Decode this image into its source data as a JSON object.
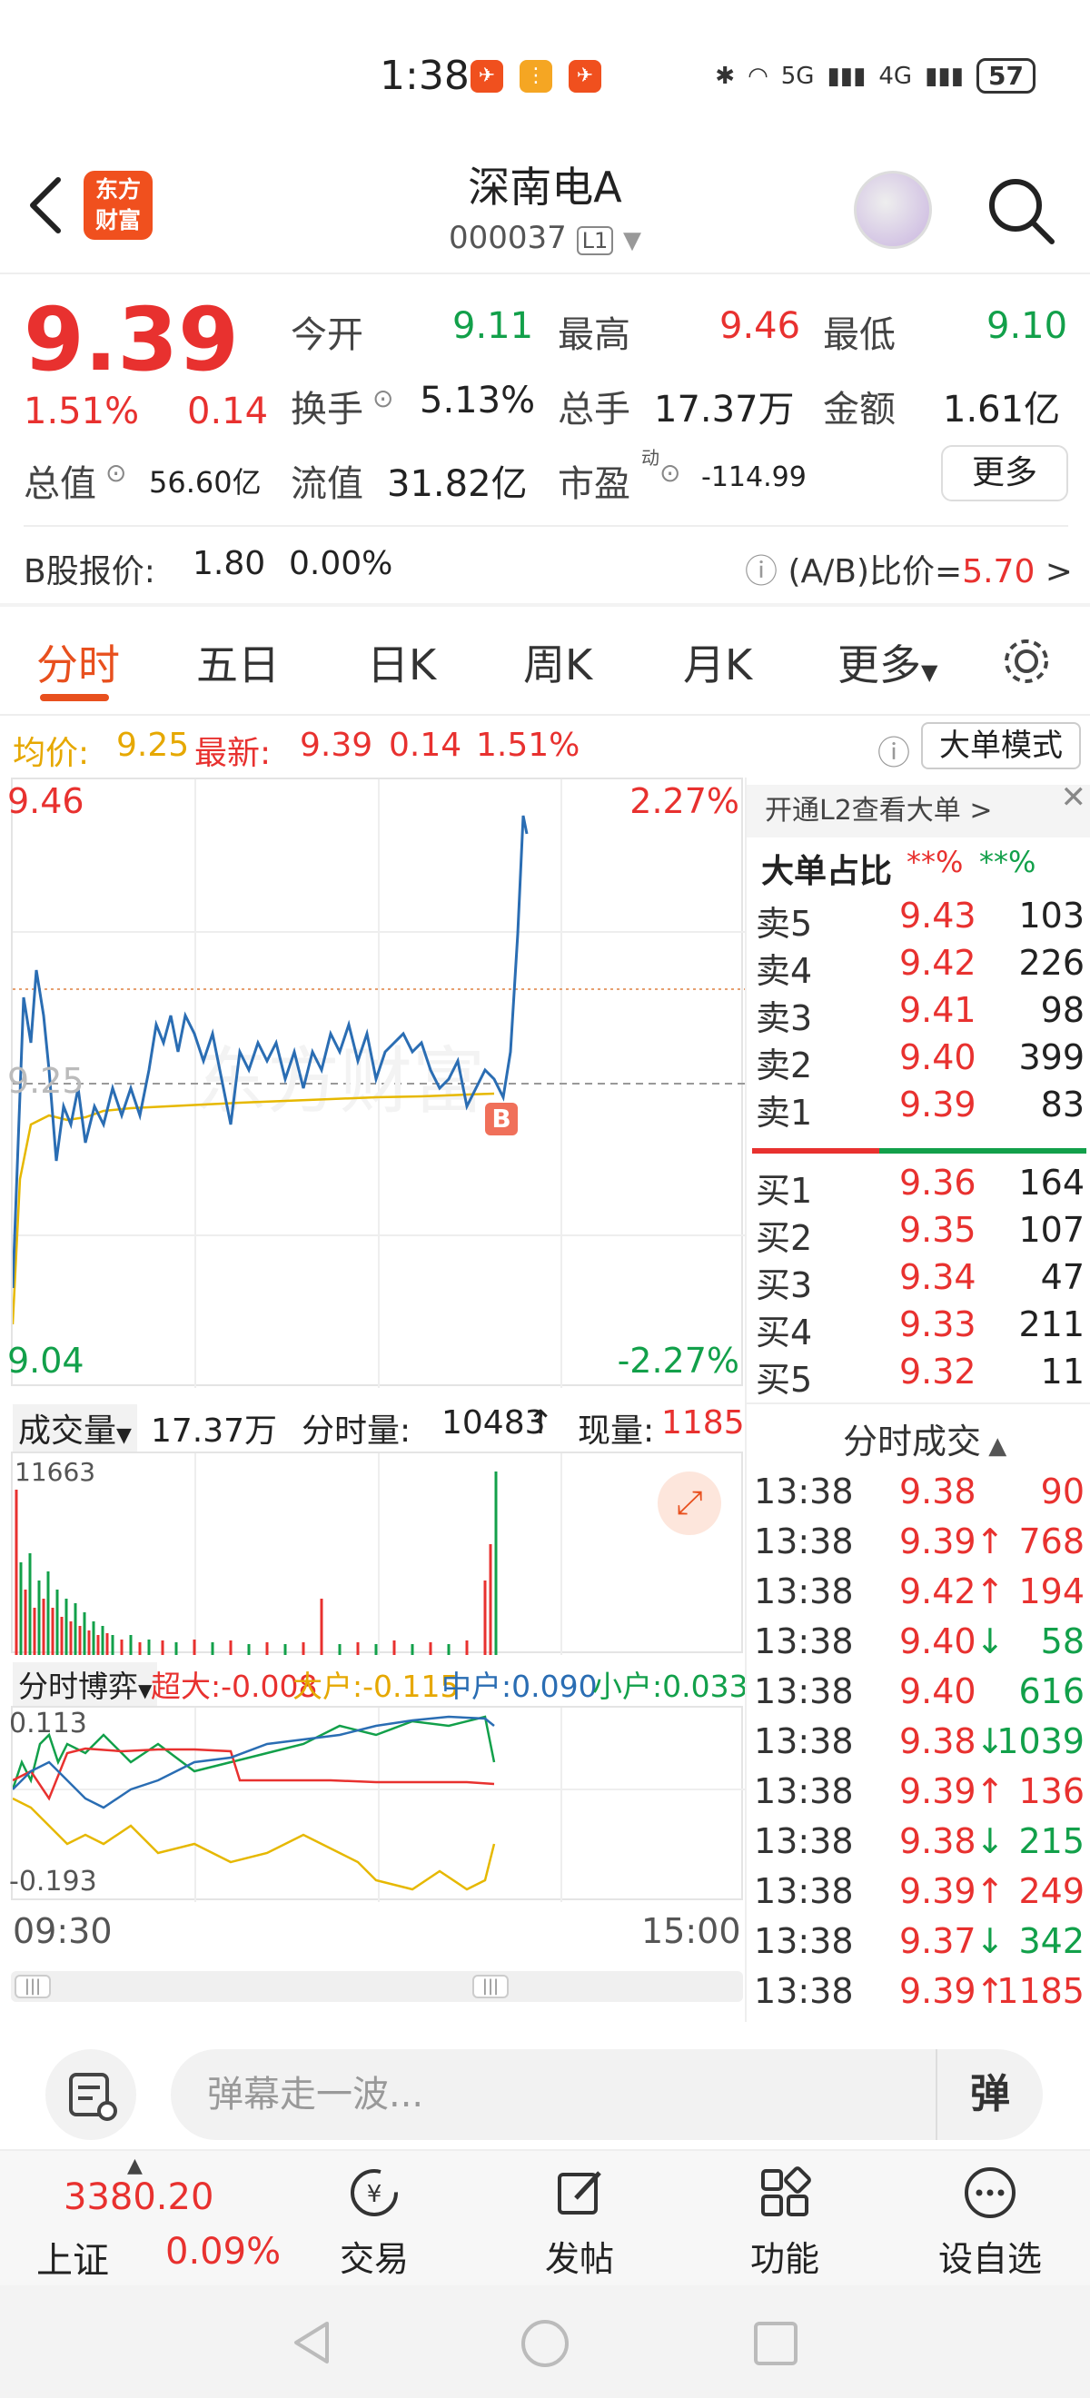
{
  "status_bar": {
    "time": "1:38",
    "network_5g": "5G",
    "network_4g": "4G",
    "battery": "57"
  },
  "header": {
    "logo_line1": "东方",
    "logo_line2": "财富",
    "stock_name": "深南电A",
    "stock_code": "000037",
    "level_badge": "L1"
  },
  "quote": {
    "price": "9.39",
    "change_pct": "1.51%",
    "change_amt": "0.14",
    "open_label": "今开",
    "open": "9.11",
    "high_label": "最高",
    "high": "9.46",
    "low_label": "最低",
    "low": "9.10",
    "turnover_label": "换手",
    "turnover": "5.13%",
    "volume_label": "总手",
    "volume": "17.37万",
    "amount_label": "金额",
    "amount": "1.61亿",
    "mktcap_label": "总值",
    "mktcap": "56.60亿",
    "float_label": "流值",
    "float_cap": "31.82亿",
    "pe_label": "市盈",
    "pe_sup": "动",
    "pe": "-114.99",
    "more_button": "更多",
    "b_share_label": "B股报价:",
    "b_share_price": "1.80",
    "b_share_pct": "0.00%",
    "ab_ratio_label": "(A/B)比价=",
    "ab_ratio": "5.70",
    "ab_arrow": ">"
  },
  "tabs": [
    {
      "label": "分时"
    },
    {
      "label": "五日"
    },
    {
      "label": "日K"
    },
    {
      "label": "周K"
    },
    {
      "label": "月K"
    },
    {
      "label": "更多"
    }
  ],
  "avg_bar": {
    "avg_label": "均价:",
    "avg_value": "9.25",
    "latest_label": "最新:",
    "latest_value": "9.39",
    "latest_change": "0.14",
    "latest_pct": "1.51%",
    "mode_button": "大单模式"
  },
  "chart": {
    "top_price": "9.46",
    "top_pct": "2.27%",
    "mid_price": "9.25",
    "bottom_price": "9.04",
    "bottom_pct": "-2.27%",
    "b_marker": "B",
    "watermark": "东方财富"
  },
  "volume": {
    "selector": "成交量",
    "total": "17.37万",
    "minute_label": "分时量:",
    "minute_value": "10483",
    "minute_arrow": "↑",
    "current_label": "现量:",
    "current_value": "1185",
    "max_label": "11663"
  },
  "game": {
    "selector": "分时博弈",
    "super_label": "超大:",
    "super_value": "-0.008",
    "large_label": "大户:",
    "large_value": "-0.115",
    "mid_label": "中户:",
    "mid_value": "0.090",
    "small_label": "小户:",
    "small_value": "0.033",
    "top_value": "0.113",
    "bottom_value": "-0.193"
  },
  "time_axis": {
    "start": "09:30",
    "end": "15:00"
  },
  "right_panel": {
    "l2_link": "开通L2查看大单 >",
    "big_ratio_label": "大单占比",
    "big_ratio_red": "**%",
    "big_ratio_green": "**%",
    "sells": [
      {
        "label": "卖5",
        "price": "9.43",
        "vol": "103"
      },
      {
        "label": "卖4",
        "price": "9.42",
        "vol": "226"
      },
      {
        "label": "卖3",
        "price": "9.41",
        "vol": "98"
      },
      {
        "label": "卖2",
        "price": "9.40",
        "vol": "399"
      },
      {
        "label": "卖1",
        "price": "9.39",
        "vol": "83"
      }
    ],
    "buys": [
      {
        "label": "买1",
        "price": "9.36",
        "vol": "164"
      },
      {
        "label": "买2",
        "price": "9.35",
        "vol": "107"
      },
      {
        "label": "买3",
        "price": "9.34",
        "vol": "47"
      },
      {
        "label": "买4",
        "price": "9.33",
        "vol": "211"
      },
      {
        "label": "买5",
        "price": "9.32",
        "vol": "11"
      }
    ],
    "deals_title": "分时成交",
    "deals": [
      {
        "time": "13:38",
        "price": "9.38",
        "arrow": "",
        "vol": "90",
        "color": "red"
      },
      {
        "time": "13:38",
        "price": "9.39",
        "arrow": "↑",
        "vol": "768",
        "color": "red"
      },
      {
        "time": "13:38",
        "price": "9.42",
        "arrow": "↑",
        "vol": "194",
        "color": "red"
      },
      {
        "time": "13:38",
        "price": "9.40",
        "arrow": "↓",
        "vol": "58",
        "color": "green"
      },
      {
        "time": "13:38",
        "price": "9.40",
        "arrow": "",
        "vol": "616",
        "color": "green"
      },
      {
        "time": "13:38",
        "price": "9.38",
        "arrow": "↓",
        "vol": "1039",
        "color": "green"
      },
      {
        "time": "13:38",
        "price": "9.39",
        "arrow": "↑",
        "vol": "136",
        "color": "red"
      },
      {
        "time": "13:38",
        "price": "9.38",
        "arrow": "↓",
        "vol": "215",
        "color": "green"
      },
      {
        "time": "13:38",
        "price": "9.39",
        "arrow": "↑",
        "vol": "249",
        "color": "red"
      },
      {
        "time": "13:38",
        "price": "9.37",
        "arrow": "↓",
        "vol": "342",
        "color": "green"
      },
      {
        "time": "13:38",
        "price": "9.39",
        "arrow": "↑",
        "vol": "1185",
        "color": "red"
      }
    ]
  },
  "danmu": {
    "placeholder": "弹幕走一波...",
    "send": "弹"
  },
  "bottom_nav": {
    "index_value": "3380.20",
    "index_name": "上证",
    "index_pct": "0.09%",
    "items": [
      {
        "label": "交易"
      },
      {
        "label": "发帖"
      },
      {
        "label": "功能"
      },
      {
        "label": "设自选"
      }
    ]
  },
  "colors": {
    "up": "#e8312f",
    "down": "#12a04a",
    "accent": "#e8501e",
    "avg_line": "#e6a800",
    "price_line": "#2a6db3"
  }
}
